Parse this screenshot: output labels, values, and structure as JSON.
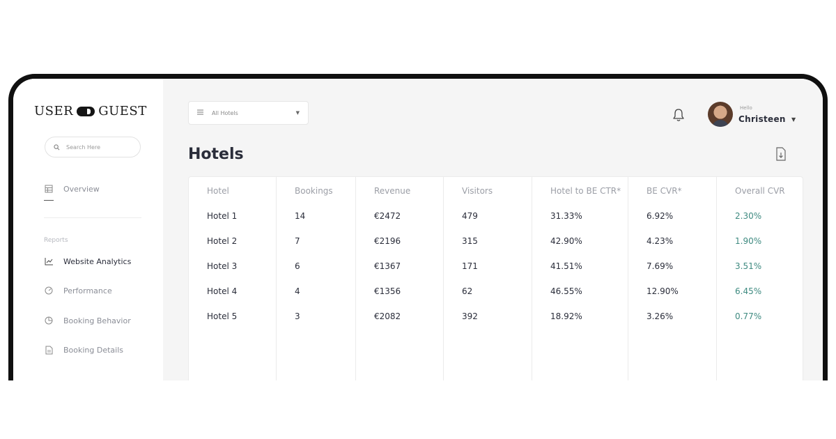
{
  "brand": {
    "left": "USER",
    "right": "GUEST"
  },
  "sidebar": {
    "search_placeholder": "Search Here",
    "overview": "Overview",
    "section_label": "Reports",
    "items": [
      {
        "label": "Website Analytics",
        "icon": "line-chart-icon"
      },
      {
        "label": "Performance",
        "icon": "gauge-icon"
      },
      {
        "label": "Booking Behavior",
        "icon": "pie-chart-icon"
      },
      {
        "label": "Booking Details",
        "icon": "document-icon"
      }
    ]
  },
  "header": {
    "hotel_filter": "All Hotels",
    "greeting": "Hello",
    "user_name": "Christeen"
  },
  "page": {
    "title": "Hotels"
  },
  "table": {
    "columns": [
      "Hotel",
      "Bookings",
      "Revenue",
      "Visitors",
      "Hotel to BE CTR*",
      "BE CVR*",
      "Overall CVR"
    ],
    "rows": [
      [
        "Hotel 1",
        "14",
        "€2472",
        "479",
        "31.33%",
        "6.92%",
        "2.30%"
      ],
      [
        "Hotel 2",
        "7",
        "€2196",
        "315",
        "42.90%",
        "4.23%",
        "1.90%"
      ],
      [
        "Hotel 3",
        "6",
        "€1367",
        "171",
        "41.51%",
        "7.69%",
        "3.51%"
      ],
      [
        "Hotel 4",
        "4",
        "€1356",
        "62",
        "46.55%",
        "12.90%",
        "6.45%"
      ],
      [
        "Hotel 5",
        "3",
        "€2082",
        "392",
        "18.92%",
        "3.26%",
        "0.77%"
      ]
    ]
  },
  "colors": {
    "accent_green": "#3e8a80",
    "text_dark": "#2a2d3a",
    "text_muted": "#9b9ea6"
  }
}
